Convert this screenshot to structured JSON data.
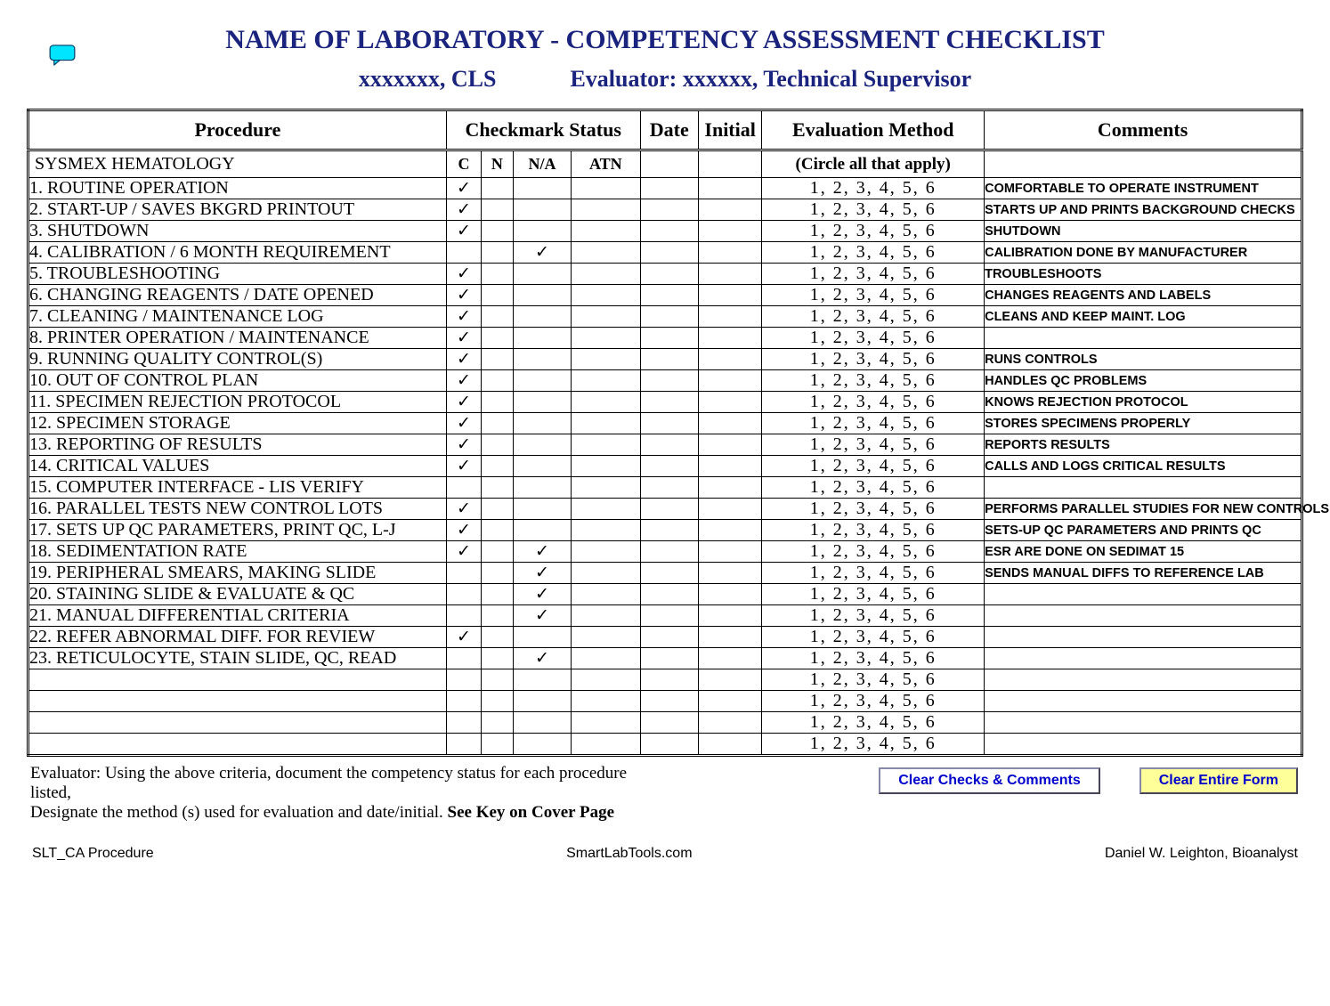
{
  "title": "NAME OF LABORATORY - COMPETENCY ASSESSMENT CHECKLIST",
  "subject": "xxxxxxx, CLS",
  "evaluator_label": "Evaluator: xxxxxx, Technical Supervisor",
  "columns": {
    "procedure": "Procedure",
    "checkmark_status": "Checkmark Status",
    "c": "C",
    "n": "N",
    "na": "N/A",
    "atn": "ATN",
    "date": "Date",
    "initial": "Initial",
    "evaluation_method": "Evaluation Method",
    "comments": "Comments"
  },
  "section_row": {
    "procedure": "SYSMEX HEMATOLOGY",
    "eval_hint": "(Circle all that apply)"
  },
  "eval_numbers": "1,  2,  3,  4,  5,  6",
  "checkmark": "✓",
  "rows": [
    {
      "procedure": "1.   ROUTINE OPERATION",
      "c": true,
      "n": false,
      "na": false,
      "atn": false,
      "comment": "COMFORTABLE TO OPERATE INSTRUMENT"
    },
    {
      "procedure": "2.   START-UP / SAVES BKGRD PRINTOUT",
      "c": true,
      "n": false,
      "na": false,
      "atn": false,
      "comment": "STARTS UP AND PRINTS BACKGROUND CHECKS"
    },
    {
      "procedure": "3.   SHUTDOWN",
      "c": true,
      "n": false,
      "na": false,
      "atn": false,
      "comment": "SHUTDOWN"
    },
    {
      "procedure": "4.   CALIBRATION / 6 MONTH REQUIREMENT",
      "c": false,
      "n": false,
      "na": true,
      "atn": false,
      "comment": "CALIBRATION DONE BY MANUFACTURER"
    },
    {
      "procedure": "5.   TROUBLESHOOTING",
      "c": true,
      "n": false,
      "na": false,
      "atn": false,
      "comment": "TROUBLESHOOTS"
    },
    {
      "procedure": "6.   CHANGING REAGENTS / DATE OPENED",
      "c": true,
      "n": false,
      "na": false,
      "atn": false,
      "comment": "CHANGES REAGENTS AND LABELS"
    },
    {
      "procedure": "7.   CLEANING / MAINTENANCE LOG",
      "c": true,
      "n": false,
      "na": false,
      "atn": false,
      "comment": "CLEANS AND KEEP MAINT. LOG"
    },
    {
      "procedure": "8.   PRINTER OPERATION / MAINTENANCE",
      "c": true,
      "n": false,
      "na": false,
      "atn": false,
      "comment": ""
    },
    {
      "procedure": "9.   RUNNING QUALITY CONTROL(S)",
      "c": true,
      "n": false,
      "na": false,
      "atn": false,
      "comment": "RUNS CONTROLS"
    },
    {
      "procedure": "10. OUT OF CONTROL PLAN",
      "c": true,
      "n": false,
      "na": false,
      "atn": false,
      "comment": "HANDLES QC PROBLEMS"
    },
    {
      "procedure": "11. SPECIMEN REJECTION PROTOCOL",
      "c": true,
      "n": false,
      "na": false,
      "atn": false,
      "comment": "KNOWS REJECTION PROTOCOL"
    },
    {
      "procedure": "12. SPECIMEN STORAGE",
      "c": true,
      "n": false,
      "na": false,
      "atn": false,
      "comment": "STORES SPECIMENS PROPERLY"
    },
    {
      "procedure": "13. REPORTING OF RESULTS",
      "c": true,
      "n": false,
      "na": false,
      "atn": false,
      "comment": "REPORTS RESULTS"
    },
    {
      "procedure": "14. CRITICAL VALUES",
      "c": true,
      "n": false,
      "na": false,
      "atn": false,
      "comment": "CALLS AND LOGS CRITICAL RESULTS"
    },
    {
      "procedure": "15. COMPUTER INTERFACE - LIS VERIFY",
      "c": false,
      "n": false,
      "na": false,
      "atn": false,
      "comment": ""
    },
    {
      "procedure": "16. PARALLEL TESTS NEW CONTROL LOTS",
      "c": true,
      "n": false,
      "na": false,
      "atn": false,
      "comment": "PERFORMS PARALLEL STUDIES FOR NEW CONTROLS"
    },
    {
      "procedure": "17. SETS UP QC PARAMETERS, PRINT QC, L-J",
      "c": true,
      "n": false,
      "na": false,
      "atn": false,
      "comment": "SETS-UP QC PARAMETERS AND PRINTS QC"
    },
    {
      "procedure": "18. SEDIMENTATION RATE",
      "c": true,
      "n": false,
      "na": true,
      "atn": false,
      "comment": "ESR ARE DONE ON SEDIMAT 15"
    },
    {
      "procedure": "19. PERIPHERAL SMEARS, MAKING SLIDE",
      "c": false,
      "n": false,
      "na": true,
      "atn": false,
      "comment": "SENDS MANUAL DIFFS TO REFERENCE LAB"
    },
    {
      "procedure": "20. STAINING SLIDE & EVALUATE & QC",
      "c": false,
      "n": false,
      "na": true,
      "atn": false,
      "comment": ""
    },
    {
      "procedure": "21. MANUAL DIFFERENTIAL CRITERIA",
      "c": false,
      "n": false,
      "na": true,
      "atn": false,
      "comment": ""
    },
    {
      "procedure": "22. REFER ABNORMAL DIFF. FOR REVIEW",
      "c": true,
      "n": false,
      "na": false,
      "atn": false,
      "comment": ""
    },
    {
      "procedure": "23. RETICULOCYTE, STAIN SLIDE, QC, READ",
      "c": false,
      "n": false,
      "na": true,
      "atn": false,
      "comment": ""
    },
    {
      "procedure": "",
      "c": false,
      "n": false,
      "na": false,
      "atn": false,
      "comment": ""
    },
    {
      "procedure": "",
      "c": false,
      "n": false,
      "na": false,
      "atn": false,
      "comment": ""
    },
    {
      "procedure": "",
      "c": false,
      "n": false,
      "na": false,
      "atn": false,
      "comment": ""
    },
    {
      "procedure": "",
      "c": false,
      "n": false,
      "na": false,
      "atn": false,
      "comment": ""
    }
  ],
  "instructions": {
    "line1": "Evaluator: Using the above criteria, document the competency status for each procedure listed,",
    "line2": "Designate the method (s) used for evaluation and date/initial.  ",
    "bold": "See Key on Cover Page"
  },
  "buttons": {
    "clear_checks": "Clear Checks & Comments",
    "clear_form": "Clear Entire Form"
  },
  "footer": {
    "left": "SLT_CA Procedure",
    "center": "SmartLabTools.com",
    "right": "Daniel W. Leighton, Bioanalyst"
  }
}
